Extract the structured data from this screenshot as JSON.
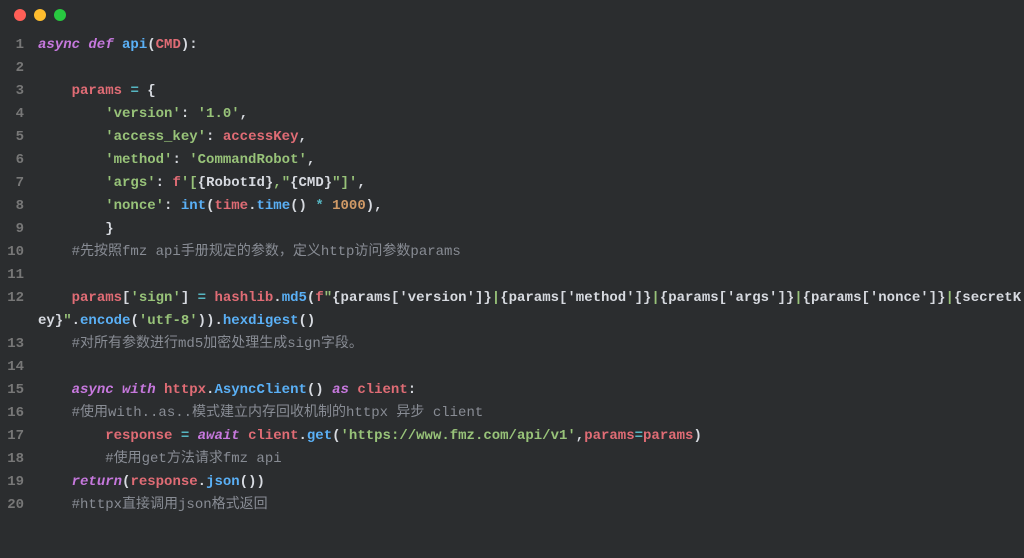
{
  "window": {
    "dots": [
      "red",
      "yellow",
      "green"
    ]
  },
  "lines": [
    {
      "n": 1,
      "tokens": [
        {
          "c": "kw",
          "t": "async def "
        },
        {
          "c": "fn",
          "t": "api"
        },
        {
          "c": "punc",
          "t": "("
        },
        {
          "c": "var",
          "t": "CMD"
        },
        {
          "c": "punc",
          "t": "):"
        }
      ]
    },
    {
      "n": 2,
      "tokens": []
    },
    {
      "n": 3,
      "tokens": [
        {
          "c": "punc",
          "t": "    "
        },
        {
          "c": "var",
          "t": "params"
        },
        {
          "c": "punc",
          "t": " "
        },
        {
          "c": "op",
          "t": "="
        },
        {
          "c": "punc",
          "t": " {"
        }
      ]
    },
    {
      "n": 4,
      "tokens": [
        {
          "c": "punc",
          "t": "        "
        },
        {
          "c": "str",
          "t": "'version'"
        },
        {
          "c": "punc",
          "t": ": "
        },
        {
          "c": "str",
          "t": "'1.0'"
        },
        {
          "c": "punc",
          "t": ","
        }
      ]
    },
    {
      "n": 5,
      "tokens": [
        {
          "c": "punc",
          "t": "        "
        },
        {
          "c": "str",
          "t": "'access_key'"
        },
        {
          "c": "punc",
          "t": ": "
        },
        {
          "c": "var",
          "t": "accessKey"
        },
        {
          "c": "punc",
          "t": ","
        }
      ]
    },
    {
      "n": 6,
      "tokens": [
        {
          "c": "punc",
          "t": "        "
        },
        {
          "c": "str",
          "t": "'method'"
        },
        {
          "c": "punc",
          "t": ": "
        },
        {
          "c": "str",
          "t": "'CommandRobot'"
        },
        {
          "c": "punc",
          "t": ","
        }
      ]
    },
    {
      "n": 7,
      "tokens": [
        {
          "c": "punc",
          "t": "        "
        },
        {
          "c": "str",
          "t": "'args'"
        },
        {
          "c": "punc",
          "t": ": "
        },
        {
          "c": "fstr",
          "t": "f"
        },
        {
          "c": "str",
          "t": "'["
        },
        {
          "c": "interp",
          "t": "{RobotId}"
        },
        {
          "c": "str",
          "t": ",\""
        },
        {
          "c": "interp",
          "t": "{CMD}"
        },
        {
          "c": "str",
          "t": "\"]'"
        },
        {
          "c": "punc",
          "t": ","
        }
      ]
    },
    {
      "n": 8,
      "tokens": [
        {
          "c": "punc",
          "t": "        "
        },
        {
          "c": "str",
          "t": "'nonce'"
        },
        {
          "c": "punc",
          "t": ": "
        },
        {
          "c": "fn",
          "t": "int"
        },
        {
          "c": "punc",
          "t": "("
        },
        {
          "c": "var",
          "t": "time"
        },
        {
          "c": "punc",
          "t": "."
        },
        {
          "c": "fn",
          "t": "time"
        },
        {
          "c": "punc",
          "t": "() "
        },
        {
          "c": "op",
          "t": "*"
        },
        {
          "c": "punc",
          "t": " "
        },
        {
          "c": "num",
          "t": "1000"
        },
        {
          "c": "punc",
          "t": "),"
        }
      ]
    },
    {
      "n": 9,
      "tokens": [
        {
          "c": "punc",
          "t": "        }"
        }
      ]
    },
    {
      "n": 10,
      "tokens": [
        {
          "c": "punc",
          "t": "    "
        },
        {
          "c": "cmt",
          "t": "#先按照fmz api手册规定的参数，定义http访问参数params"
        }
      ]
    },
    {
      "n": 11,
      "tokens": []
    },
    {
      "n": 12,
      "tokens": [
        {
          "c": "punc",
          "t": "    "
        },
        {
          "c": "var",
          "t": "params"
        },
        {
          "c": "punc",
          "t": "["
        },
        {
          "c": "str",
          "t": "'sign'"
        },
        {
          "c": "punc",
          "t": "] "
        },
        {
          "c": "op",
          "t": "="
        },
        {
          "c": "punc",
          "t": " "
        },
        {
          "c": "var",
          "t": "hashlib"
        },
        {
          "c": "punc",
          "t": "."
        },
        {
          "c": "fn",
          "t": "md5"
        },
        {
          "c": "punc",
          "t": "("
        },
        {
          "c": "fstr",
          "t": "f"
        },
        {
          "c": "str",
          "t": "\""
        },
        {
          "c": "interp",
          "t": "{params['version']}"
        },
        {
          "c": "str",
          "t": "|"
        },
        {
          "c": "interp",
          "t": "{params['method']}"
        },
        {
          "c": "str",
          "t": "|"
        },
        {
          "c": "interp",
          "t": "{params['args']}"
        },
        {
          "c": "str",
          "t": "|"
        },
        {
          "c": "interp",
          "t": "{params['nonce']}"
        },
        {
          "c": "str",
          "t": "|"
        },
        {
          "c": "interp",
          "t": "{secretKey}"
        },
        {
          "c": "str",
          "t": "\""
        },
        {
          "c": "punc",
          "t": "."
        },
        {
          "c": "fn",
          "t": "encode"
        },
        {
          "c": "punc",
          "t": "("
        },
        {
          "c": "str",
          "t": "'utf-8'"
        },
        {
          "c": "punc",
          "t": "))."
        },
        {
          "c": "fn",
          "t": "hexdigest"
        },
        {
          "c": "punc",
          "t": "()"
        }
      ]
    },
    {
      "n": 13,
      "tokens": [
        {
          "c": "punc",
          "t": "    "
        },
        {
          "c": "cmt",
          "t": "#对所有参数进行md5加密处理生成sign字段。"
        }
      ]
    },
    {
      "n": 14,
      "tokens": []
    },
    {
      "n": 15,
      "tokens": [
        {
          "c": "punc",
          "t": "    "
        },
        {
          "c": "kw",
          "t": "async with "
        },
        {
          "c": "var",
          "t": "httpx"
        },
        {
          "c": "punc",
          "t": "."
        },
        {
          "c": "fn",
          "t": "AsyncClient"
        },
        {
          "c": "punc",
          "t": "() "
        },
        {
          "c": "kw",
          "t": "as "
        },
        {
          "c": "var",
          "t": "client"
        },
        {
          "c": "punc",
          "t": ":"
        }
      ]
    },
    {
      "n": 16,
      "tokens": [
        {
          "c": "punc",
          "t": "    "
        },
        {
          "c": "cmt",
          "t": "#使用with..as..模式建立内存回收机制的httpx 异步 client"
        }
      ]
    },
    {
      "n": 17,
      "tokens": [
        {
          "c": "punc",
          "t": "        "
        },
        {
          "c": "var",
          "t": "response"
        },
        {
          "c": "punc",
          "t": " "
        },
        {
          "c": "op",
          "t": "="
        },
        {
          "c": "punc",
          "t": " "
        },
        {
          "c": "kw",
          "t": "await "
        },
        {
          "c": "var",
          "t": "client"
        },
        {
          "c": "punc",
          "t": "."
        },
        {
          "c": "fn",
          "t": "get"
        },
        {
          "c": "punc",
          "t": "("
        },
        {
          "c": "str",
          "t": "'https://www.fmz.com/api/v1'"
        },
        {
          "c": "punc",
          "t": ","
        },
        {
          "c": "var",
          "t": "params"
        },
        {
          "c": "op",
          "t": "="
        },
        {
          "c": "var",
          "t": "params"
        },
        {
          "c": "punc",
          "t": ")"
        }
      ]
    },
    {
      "n": 18,
      "tokens": [
        {
          "c": "punc",
          "t": "        "
        },
        {
          "c": "cmt",
          "t": "#使用get方法请求fmz api"
        }
      ]
    },
    {
      "n": 19,
      "tokens": [
        {
          "c": "punc",
          "t": "    "
        },
        {
          "c": "kw",
          "t": "return"
        },
        {
          "c": "punc",
          "t": "("
        },
        {
          "c": "var",
          "t": "response"
        },
        {
          "c": "punc",
          "t": "."
        },
        {
          "c": "fn",
          "t": "json"
        },
        {
          "c": "punc",
          "t": "())"
        }
      ]
    },
    {
      "n": 20,
      "tokens": [
        {
          "c": "punc",
          "t": "    "
        },
        {
          "c": "cmt",
          "t": "#httpx直接调用json格式返回"
        }
      ]
    }
  ]
}
